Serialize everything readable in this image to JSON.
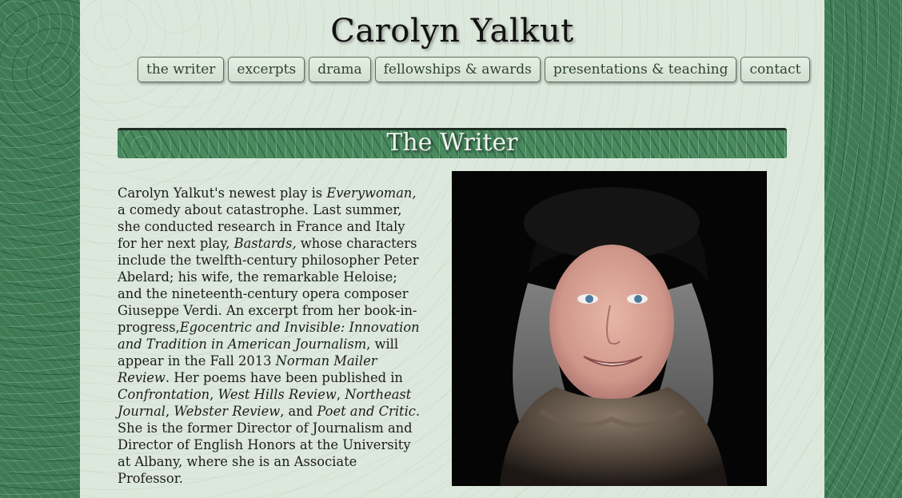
{
  "site": {
    "title": "Carolyn Yalkut"
  },
  "nav": {
    "items": [
      {
        "label": "the writer"
      },
      {
        "label": "excerpts"
      },
      {
        "label": "drama"
      },
      {
        "label": "fellowships & awards"
      },
      {
        "label": "presentations & teaching"
      },
      {
        "label": "contact"
      }
    ]
  },
  "section": {
    "title": "The Writer"
  },
  "bio": {
    "segments": [
      {
        "text": "Carolyn Yalkut's newest play is ",
        "italic": false
      },
      {
        "text": "Everywoman,",
        "italic": true
      },
      {
        "text": " a comedy about catastrophe.  Last summer, she conducted research in France and Italy for her next play, ",
        "italic": false
      },
      {
        "text": "Bastards,",
        "italic": true
      },
      {
        "text": " whose characters include the twelfth-century philosopher Peter Abelard; his wife, the remarkable Heloise; and the nineteenth-century opera composer Giuseppe Verdi. An excerpt from her book-in-progress,",
        "italic": false
      },
      {
        "text": "Egocentric and Invisible: Innovation and Tradition in American Journalism",
        "italic": true
      },
      {
        "text": ", will appear in the Fall 2013 ",
        "italic": false
      },
      {
        "text": "Norman Mailer Review",
        "italic": true
      },
      {
        "text": ". Her poems have been published in ",
        "italic": false
      },
      {
        "text": "Confrontation",
        "italic": true
      },
      {
        "text": ", ",
        "italic": false
      },
      {
        "text": "West Hills Review",
        "italic": true
      },
      {
        "text": ", ",
        "italic": false
      },
      {
        "text": "Northeast Journal",
        "italic": true
      },
      {
        "text": ", ",
        "italic": false
      },
      {
        "text": "Webster Review",
        "italic": true
      },
      {
        "text": ", and ",
        "italic": false
      },
      {
        "text": "Poet and Critic",
        "italic": true
      },
      {
        "text": ". She is the former Director of Journalism and Director of English Honors at the University at Albany, where she is an Associate Professor.",
        "italic": false
      }
    ]
  },
  "colors": {
    "frame_background": "#3f7a55",
    "page_background": "#dde8dc",
    "nav_text": "#2d4433",
    "banner_background": "#4a8a5f"
  }
}
